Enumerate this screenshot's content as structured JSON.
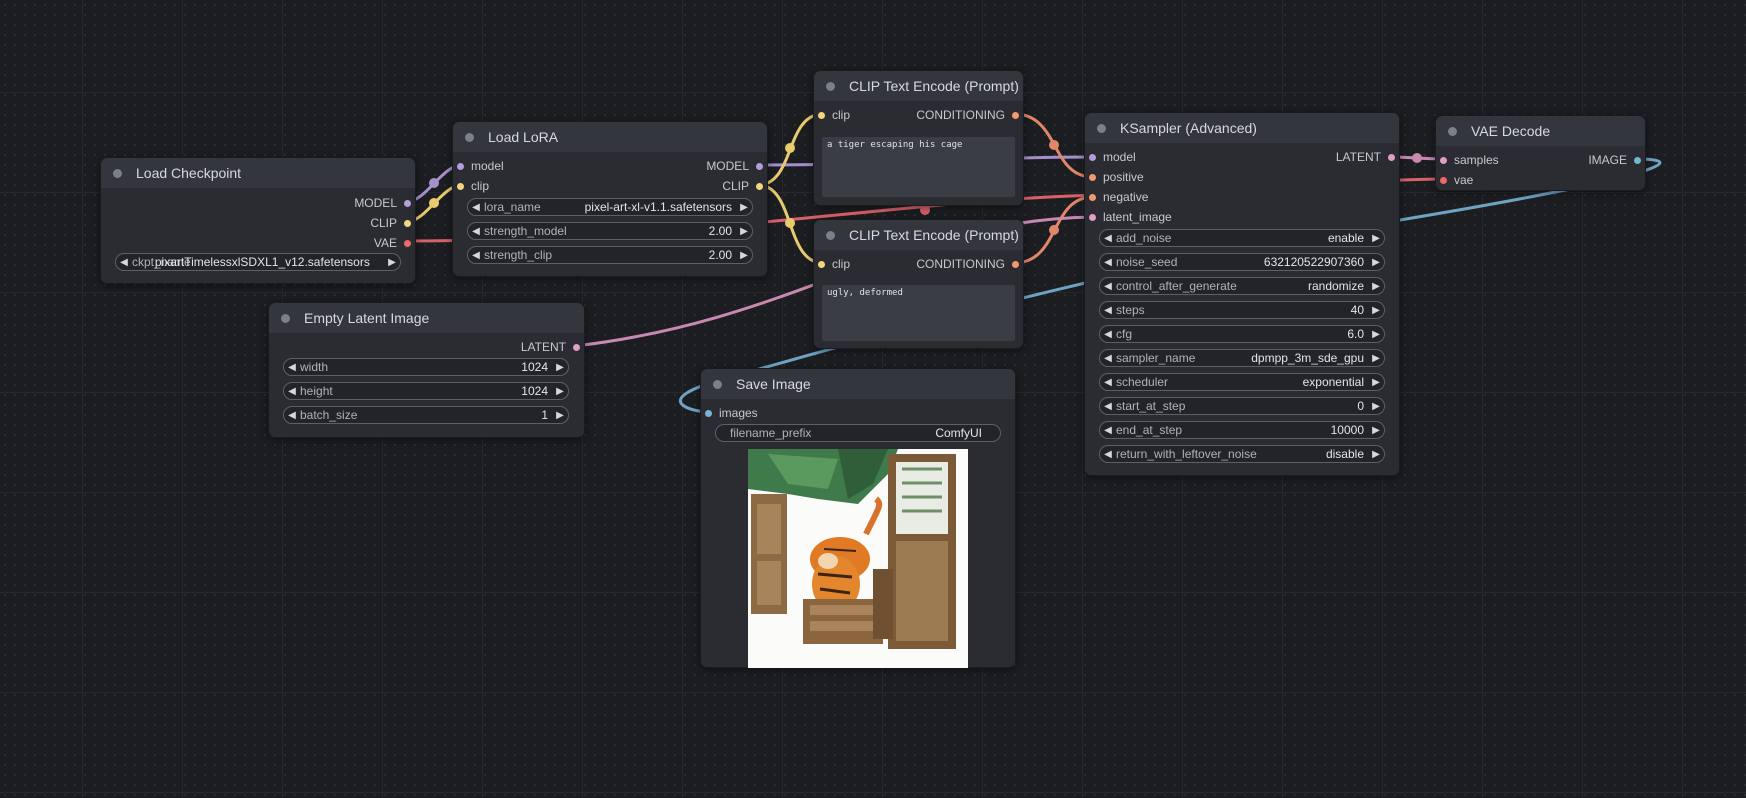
{
  "nodes": {
    "load_checkpoint": {
      "title": "Load Checkpoint",
      "outputs": [
        "MODEL",
        "CLIP",
        "VAE"
      ],
      "ckpt_label": "ckpt_name",
      "ckpt_value": "pixartTimelessxlSDXL1_v12.safetensors"
    },
    "load_lora": {
      "title": "Load LoRA",
      "inputs": [
        "model",
        "clip"
      ],
      "outputs": [
        "MODEL",
        "CLIP"
      ],
      "widgets": [
        {
          "label": "lora_name",
          "value": "pixel-art-xl-v1.1.safetensors"
        },
        {
          "label": "strength_model",
          "value": "2.00"
        },
        {
          "label": "strength_clip",
          "value": "2.00"
        }
      ]
    },
    "clip_positive": {
      "title": "CLIP Text Encode (Prompt)",
      "input": "clip",
      "output": "CONDITIONING",
      "text": "a tiger escaping his cage"
    },
    "clip_negative": {
      "title": "CLIP Text Encode (Prompt)",
      "input": "clip",
      "output": "CONDITIONING",
      "text": "ugly, deformed"
    },
    "empty_latent": {
      "title": "Empty Latent Image",
      "output": "LATENT",
      "widgets": [
        {
          "label": "width",
          "value": "1024"
        },
        {
          "label": "height",
          "value": "1024"
        },
        {
          "label": "batch_size",
          "value": "1"
        }
      ]
    },
    "ksampler": {
      "title": "KSampler (Advanced)",
      "inputs": [
        "model",
        "positive",
        "negative",
        "latent_image"
      ],
      "output": "LATENT",
      "widgets": [
        {
          "label": "add_noise",
          "value": "enable"
        },
        {
          "label": "noise_seed",
          "value": "632120522907360"
        },
        {
          "label": "control_after_generate",
          "value": "randomize"
        },
        {
          "label": "steps",
          "value": "40"
        },
        {
          "label": "cfg",
          "value": "6.0"
        },
        {
          "label": "sampler_name",
          "value": "dpmpp_3m_sde_gpu"
        },
        {
          "label": "scheduler",
          "value": "exponential"
        },
        {
          "label": "start_at_step",
          "value": "0"
        },
        {
          "label": "end_at_step",
          "value": "10000"
        },
        {
          "label": "return_with_leftover_noise",
          "value": "disable"
        }
      ]
    },
    "vae_decode": {
      "title": "VAE Decode",
      "inputs": [
        "samples",
        "vae"
      ],
      "output": "IMAGE"
    },
    "save_image": {
      "title": "Save Image",
      "input": "images",
      "prefix_label": "filename_prefix",
      "prefix_value": "ComfyUI"
    }
  },
  "colors": {
    "model": "#b39ddb",
    "clip": "#f3d67c",
    "vae": "#ec6a6a",
    "conditioning": "#f09b6e",
    "latent": "#e09fc3",
    "image": "#76b4d8"
  }
}
